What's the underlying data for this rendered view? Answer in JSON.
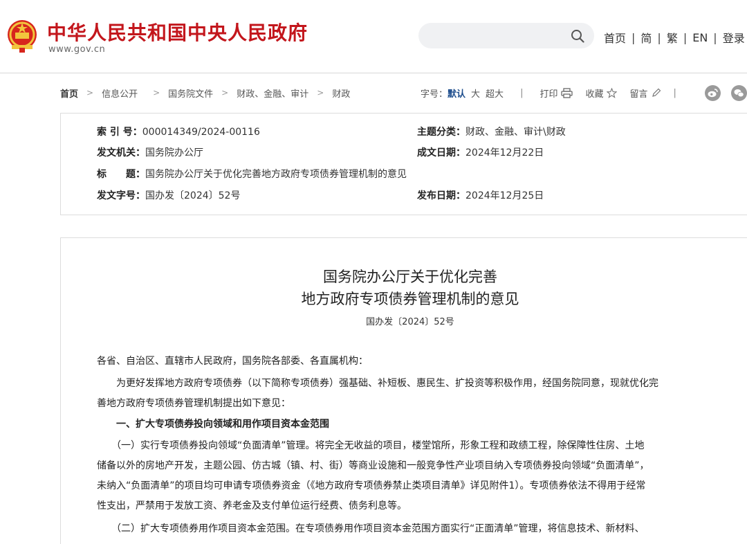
{
  "header": {
    "site_title": "中华人民共和国中央人民政府",
    "site_url": "www.gov.cn",
    "search": {
      "placeholder": ""
    },
    "nav": [
      "首页",
      "简",
      "繁",
      "EN",
      "登录"
    ],
    "nav_sep": "|"
  },
  "breadcrumb": {
    "items": [
      "首页",
      "信息公开",
      "国务院文件",
      "财政、金融、审计",
      "财政"
    ],
    "arrow": ">"
  },
  "tools": {
    "font_label": "字号：",
    "font_default": "默认",
    "font_large": "大",
    "font_xlarge": "超大",
    "bar": "|",
    "print": "打印",
    "favorite": "收藏",
    "comment": "留言",
    "icons": [
      "printer-icon",
      "star-icon",
      "pencil-icon",
      "weibo-icon",
      "wechat-icon"
    ]
  },
  "info": {
    "index_label": "索 引 号：",
    "index_value": "000014349/2024-00116",
    "issuer_label": "发文机关：",
    "issuer_value": "国务院办公厅",
    "title_label": "标　　题：",
    "title_value": "国务院办公厅关于优化完善地方政府专项债券管理机制的意见",
    "docno_label": "发文字号：",
    "docno_value": "国办发〔2024〕52号",
    "topic_label": "主题分类：",
    "topic_value": "财政、金融、审计\\财政",
    "written_label": "成文日期：",
    "written_value": "2024年12月22日",
    "published_label": "发布日期：",
    "published_value": "2024年12月25日"
  },
  "article": {
    "title_line1": "国务院办公厅关于优化完善",
    "title_line2": "地方政府专项债券管理机制的意见",
    "doc_no": "国办发〔2024〕52号",
    "salutation": "各省、自治区、直辖市人民政府，国务院各部委、各直属机构：",
    "intro_line1": "　　为更好发挥地方政府专项债券（以下简称专项债券）强基础、补短板、惠民生、扩投资等积极作用，经国务院同意，现就优化完",
    "intro_line2": "善地方政府专项债券管理机制提出如下意见：",
    "section1": "　　一、扩大专项债券投向领域和用作项目资本金范围",
    "p1_line1": "　　（一）实行专项债券投向领域“负面清单”管理。将完全无收益的项目，楼堂馆所，形象工程和政绩工程，除保障性住房、土地",
    "p1_line2": "储备以外的房地产开发，主题公园、仿古城（镇、村、街）等商业设施和一般竞争性产业项目纳入专项债券投向领域“负面清单”，",
    "p1_line3": "未纳入“负面清单”的项目均可申请专项债券资金（《地方政府专项债券禁止类项目清单》详见附件1）。专项债券依法不得用于经常",
    "p1_line4": "性支出，严禁用于发放工资、养老金及支付单位运行经费、债务利息等。",
    "p2_line1": "　　（二）扩大专项债券用作项目资本金范围。在专项债券用作项目资本金范围方面实行“正面清单”管理，将信息技术、新材料、"
  },
  "colors": {
    "brand_red": "#c3161c",
    "link_blue": "#1c4c8c",
    "border": "#dcdcdc"
  }
}
